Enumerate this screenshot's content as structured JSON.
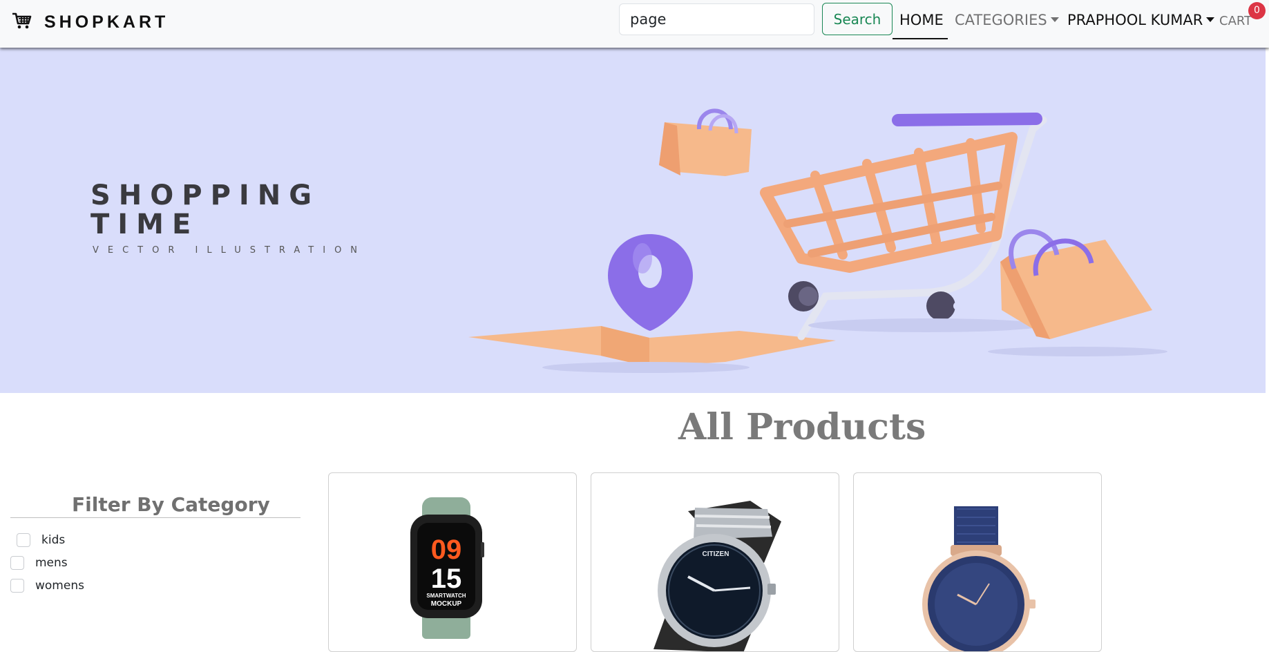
{
  "navbar": {
    "brand": "SHOPKART",
    "brand_icon": "shopping-cart-icon",
    "search": {
      "value": "page",
      "placeholder": "Search"
    },
    "search_button": "Search",
    "links": {
      "home": "HOME",
      "categories": "CATEGORIES",
      "user": "PRAPHOOL KUMAR",
      "cart": "CART"
    },
    "cart_count": "0",
    "colors": {
      "search_button": "#198754",
      "badge": "#dc3545"
    }
  },
  "hero": {
    "title_line1": "SHOPPING",
    "title_line2": "TIME",
    "subtitle": "VECTOR ILLUSTRATION",
    "background": "#d9ddfb"
  },
  "main": {
    "title": "All Products"
  },
  "filter": {
    "title": "Filter By Category",
    "options": [
      "kids",
      "mens",
      "womens"
    ]
  },
  "products": [
    {
      "image": "smartwatch-image",
      "watch_face_lines": [
        "09",
        "15",
        "SMARTWATCH",
        "MOCKUP"
      ]
    },
    {
      "image": "citizen-watch-image",
      "brand_mark": "CITIZEN"
    },
    {
      "image": "blue-mesh-watch-image"
    }
  ]
}
